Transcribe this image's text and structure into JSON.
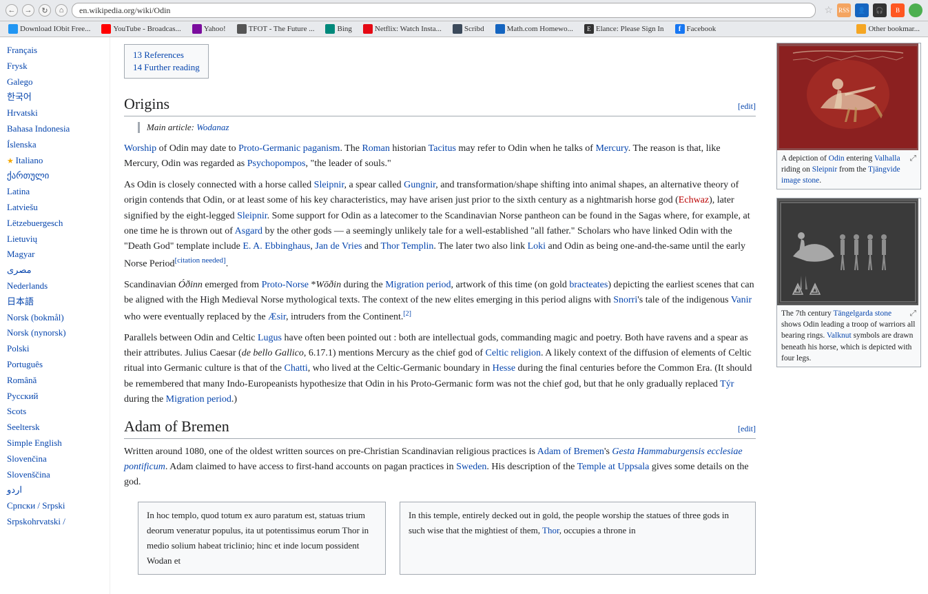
{
  "browser": {
    "url": "en.wikipedia.org/wiki/Odin",
    "nav_buttons": [
      "←",
      "→",
      "↻",
      "⌂"
    ],
    "star_label": "☆",
    "bookmarks": [
      {
        "label": "Download IObit Free...",
        "color": "#2196F3"
      },
      {
        "label": "YouTube - Broadcas...",
        "color": "#FF0000"
      },
      {
        "label": "Yahoo!",
        "color": "#7B0D9E"
      },
      {
        "label": "TFOT - The Future ...",
        "color": "#333"
      },
      {
        "label": "Bing",
        "color": "#00897B"
      },
      {
        "label": "Netflix: Watch Insta...",
        "color": "#E50914"
      },
      {
        "label": "Scribd",
        "color": "#333"
      },
      {
        "label": "Math.com Homewo...",
        "color": "#333"
      },
      {
        "label": "Elance: Please Sign In",
        "color": "#333"
      },
      {
        "label": "Facebook",
        "color": "#1877F2"
      },
      {
        "label": "Other bookmar...",
        "color": "#F5A623"
      }
    ]
  },
  "sidebar": {
    "languages": [
      {
        "label": "Français",
        "active": false,
        "starred": false
      },
      {
        "label": "Frysk",
        "active": false,
        "starred": false
      },
      {
        "label": "Galego",
        "active": false,
        "starred": false
      },
      {
        "label": "한국어",
        "active": false,
        "starred": false
      },
      {
        "label": "Hrvatski",
        "active": false,
        "starred": false
      },
      {
        "label": "Bahasa Indonesia",
        "active": false,
        "starred": false
      },
      {
        "label": "Íslenska",
        "active": false,
        "starred": false
      },
      {
        "label": "Italiano",
        "active": false,
        "starred": true
      },
      {
        "label": "ქართული",
        "active": false,
        "starred": false
      },
      {
        "label": "Latina",
        "active": false,
        "starred": false
      },
      {
        "label": "Latviešu",
        "active": false,
        "starred": false
      },
      {
        "label": "Lëtzebuergesch",
        "active": false,
        "starred": false
      },
      {
        "label": "Lietuvių",
        "active": false,
        "starred": false
      },
      {
        "label": "Magyar",
        "active": false,
        "starred": false
      },
      {
        "label": "مصرى",
        "active": false,
        "starred": false
      },
      {
        "label": "Nederlands",
        "active": false,
        "starred": false
      },
      {
        "label": "日本語",
        "active": false,
        "starred": false
      },
      {
        "label": "Norsk (bokmål)",
        "active": false,
        "starred": false
      },
      {
        "label": "Norsk (nynorsk)",
        "active": false,
        "starred": false
      },
      {
        "label": "Polski",
        "active": false,
        "starred": false
      },
      {
        "label": "Português",
        "active": false,
        "starred": false
      },
      {
        "label": "Română",
        "active": false,
        "starred": false
      },
      {
        "label": "Русский",
        "active": false,
        "starred": false
      },
      {
        "label": "Scots",
        "active": false,
        "starred": false
      },
      {
        "label": "Seeltersk",
        "active": false,
        "starred": false
      },
      {
        "label": "Simple English",
        "active": false,
        "starred": false
      },
      {
        "label": "Slovenčina",
        "active": false,
        "starred": false
      },
      {
        "label": "Slovenščina",
        "active": false,
        "starred": false
      },
      {
        "label": "اردو",
        "active": false,
        "starred": false
      },
      {
        "label": "Српски / Srpski",
        "active": false,
        "starred": false
      },
      {
        "label": "Srpskohrvatski /",
        "active": false,
        "starred": false
      }
    ]
  },
  "toc": {
    "items": [
      {
        "number": "13",
        "label": "References"
      },
      {
        "number": "14",
        "label": "Further reading"
      }
    ]
  },
  "sections": {
    "origins": {
      "heading": "Origins",
      "edit_label": "[edit]",
      "main_article_prefix": "Main article:",
      "main_article_link": "Wodanaz",
      "paragraphs": [
        "Worship of Odin may date to Proto-Germanic paganism. The Roman historian Tacitus may refer to Odin when he talks of Mercury. The reason is that, like Mercury, Odin was regarded as Psychopompos, \"the leader of souls.\"",
        "As Odin is closely connected with a horse called Sleipnir, a spear called Gungnir, and transformation/shape shifting into animal shapes, an alternative theory of origin contends that Odin, or at least some of his key characteristics, may have arisen just prior to the sixth century as a nightmarish horse god (Echwaz), later signified by the eight-legged Sleipnir. Some support for Odin as a latecomer to the Scandinavian Norse pantheon can be found in the Sagas where, for example, at one time he is thrown out of Asgard by the other gods — a seemingly unlikely tale for a well-established \"all father.\" Scholars who have linked Odin with the \"Death God\" template include E. A. Ebbinghaus, Jan de Vries and Thor Templin. The later two also link Loki and Odin as being one-and-the-same until the early Norse Period[citation needed].",
        "Scandinavian Óðinn emerged from Proto-Norse *Wōðin during the Migration period, artwork of this time (on gold bracteates) depicting the earliest scenes that can be aligned with the High Medieval Norse mythological texts. The context of the new elites emerging in this period aligns with Snorri's tale of the indigenous Vanir who were eventually replaced by the Æsir, intruders from the Continent.[2]",
        "Parallels between Odin and Celtic Lugus have often been pointed out : both are intellectual gods, commanding magic and poetry. Both have ravens and a spear as their attributes. Julius Caesar (de bello Gallico, 6.17.1) mentions Mercury as the chief god of Celtic religion. A likely context of the diffusion of elements of Celtic ritual into Germanic culture is that of the Chatti, who lived at the Celtic-Germanic boundary in Hesse during the final centuries before the Common Era. (It should be remembered that many Indo-Europeanists hypothesize that Odin in his Proto-Germanic form was not the chief god, but that he only gradually replaced Týr during the Migration period.)"
      ]
    },
    "adam_of_bremen": {
      "heading": "Adam of Bremen",
      "edit_label": "[edit]",
      "paragraph1": "Written around 1080, one of the oldest written sources on pre-Christian Scandinavian religious practices is Adam of Bremen's Gesta Hammaburgensis ecclesiae pontificum. Adam claimed to have access to first-hand accounts on pagan practices in Sweden. His description of the Temple at Uppsala gives some details on the god.",
      "latin_text": "In hoc templo, quod totum ex auro paratum est, statuas trium deorum veneratur populus, ita ut potentissimus eorum Thor in medio solium habeat triclinio; hinc et inde locum possident Wodan et",
      "english_text": "In this temple, entirely decked out in gold, the people worship the statues of three gods in such wise that the mightiest of them, Thor, occupies a throne in"
    }
  },
  "images": [
    {
      "alt": "Depiction of Odin entering Valhalla",
      "caption": "A depiction of Odin entering Valhalla riding on Sleipnir from the Tjängvide image stone.",
      "links": [
        "Odin",
        "Valhalla",
        "Sleipnir",
        "Tjängvide image stone"
      ]
    },
    {
      "alt": "Tangelgarda stone",
      "caption": "The 7th century Tängelgarda stone shows Odin leading a troop of warriors all bearing rings. Valknut symbols are drawn beneath his horse, which is depicted with four legs.",
      "links": [
        "Tängelgarda stone",
        "Odin",
        "Valknut"
      ]
    }
  ]
}
